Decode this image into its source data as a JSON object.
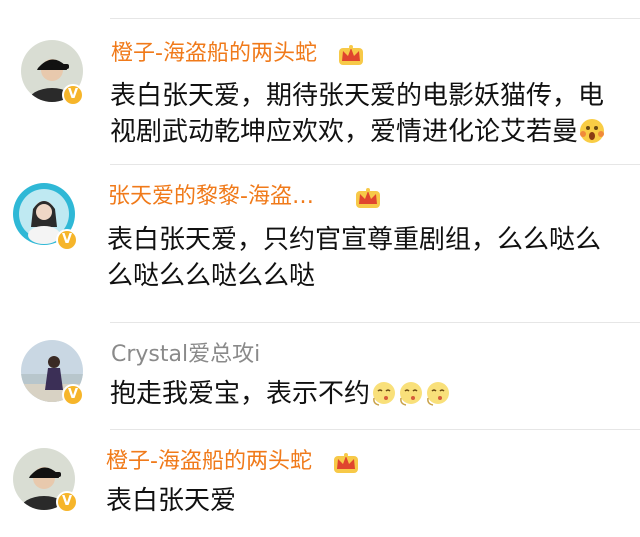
{
  "comments": [
    {
      "user": "橙子-海盗船的两头蛇",
      "lines": [
        "表白张天爱，期待张天爱的电影妖猫传，电",
        "视剧武动乾坤应欢欢，爱情进化论艾若曼"
      ],
      "verified": "V",
      "crown": "crown-icon",
      "emoji": "shocked-face-emoji"
    },
    {
      "user": "张天爱的黎黎-海盗…",
      "lines": [
        "表白张天爱，只约官宣尊重剧组，么么哒么",
        "么哒么么哒么么哒"
      ],
      "verified": "V",
      "crown": "crown-icon"
    },
    {
      "user": "Crystal爱总攻i",
      "lines": [
        "抱走我爱宝，表示不约"
      ],
      "verified": "V",
      "emoji": "blowing-kiss-emoji"
    },
    {
      "user": "橙子-海盗船的两头蛇",
      "lines": [
        "表白张天爱"
      ],
      "verified": "V",
      "crown": "crown-icon"
    }
  ],
  "colors": {
    "username": "#f07a1a",
    "username_plain": "#8a8a8a",
    "badge": "#f6b52a",
    "text": "#111111"
  }
}
